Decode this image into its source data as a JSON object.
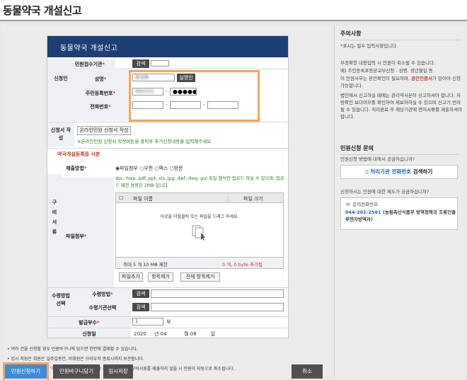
{
  "page_title": "동물약국 개설신고",
  "form": {
    "header": "동물약국 개설신고",
    "receiving_agency": {
      "label": "민원접수기관",
      "button": "검색"
    },
    "applicant": {
      "section_label": "신청인",
      "name_label": "성명",
      "name_value": "홍길동",
      "verify_button": "실명인",
      "rrn_label": "주민등록번호",
      "rrn_front": "900101",
      "rrn_dash": "-",
      "rrn_back": "●●●●●●",
      "phone_label": "전화번호",
      "phone_dash": "-"
    },
    "application_write": {
      "section_label": "신청서 작성",
      "button": "온라인민원 신청서 작성",
      "note": "※온라인민원 신청서 작성버튼을 클릭후 추가신청내용을 입력해주세요"
    },
    "registration": {
      "subtitle": "약국개설등록증 사본"
    },
    "documents": {
      "section_label": "구비서류",
      "submit_method_label": "제출방법",
      "submit_options": [
        "파일첨부",
        "우편",
        "팩스",
        "방문"
      ],
      "file_note": "doc, hwp, pdf, ppt, xls, jpg, dwf, dwg, gul 파일 형식만 업로드 하실 수 있으며, 업로드 제한 용량은 2MB 입니다.",
      "attach_label": "파일첨부",
      "col_name": "파일 이름",
      "col_size": "파일 크기",
      "drop_hint": "이곳을 더블클릭 또는 파일을 드래그 하세요.",
      "limit_text": "최대 5 개 10 MB 제한",
      "added_text": "0 개, 0 byte 추가됨",
      "btn_add": "파일추가",
      "btn_remove": "항목제거",
      "btn_remove_all": "전체 항목제거"
    },
    "receive": {
      "section_label": "수령방법 선택",
      "method_label": "수령방법",
      "agency_label": "수령기관선택",
      "button": "검색"
    },
    "copies": {
      "label": "발급부수",
      "value": "1",
      "unit": "부"
    },
    "date": {
      "label": "신청일",
      "year": "2020",
      "year_unit": "년",
      "month": "04",
      "month_unit": "월",
      "day": "08",
      "day_unit": "일"
    }
  },
  "notes": [
    "• 여러 건을 신청할 경우 민원바구니에 담으면 한번에 결제할 수 있습니다.",
    "• 임시 저장은 회원은 일주일동안, 비회원은 브라우저 종료시까지 보관됩니다.",
    "• 구비서류 제출 방법이 '우편/팩스/방문'인 경우 신청 후 30일 이내에 구비서류를 제출하지 않을 시 민원이 자동으로 취소됩니다."
  ],
  "buttons": {
    "apply": "민원신청하기",
    "basket": "민원바구니담기",
    "temp_save": "임시저장",
    "cancel": "취소"
  },
  "sidebar": {
    "notice_title": "주의사항",
    "notice_required": "*표시는 필수 입력사항입니다.",
    "notice_text_1": "부정확한 내용입력 시 민원이 취소될 수 있습니다.",
    "notice_text_2": "예) 주민등록표등본교부신청 : 성명, 생년월일 등",
    "notice_text_3a": "이 민원사무는 본인확인이 필요하며, ",
    "notice_text_3b": "공인인증서",
    "notice_text_3c": "가 있어야 신청가능합니다.",
    "notice_text_4": "법인에서 신고하실 때에는 관리약사본이 신고하셔야 합니다. 처방확인 보다여부를 확인하여 제보하하실 수 있으며 신고가 반려될 수 있습니다. 처리완료 후 해당기관에 면허서류를 제출하셔야 합니다.",
    "inquiry_title": "민원신청 문의",
    "inquiry_text": "민원신청 방법에 대해서 궁금하십니까?",
    "inquiry_button": "처리기관 전화번호",
    "inquiry_button_suffix": " 검색하기",
    "system_text": "신청하시는 민원에 대한 제도가 궁금하십니까?",
    "contact_label": "문의전화번호",
    "contact_phone": "044-201-2561",
    "contact_org": " (농림축산식품부 방역정책국 조류인플루엔자방역과)",
    "accent_color": "#1a5fb0",
    "highlight_color": "#f7a35c"
  }
}
